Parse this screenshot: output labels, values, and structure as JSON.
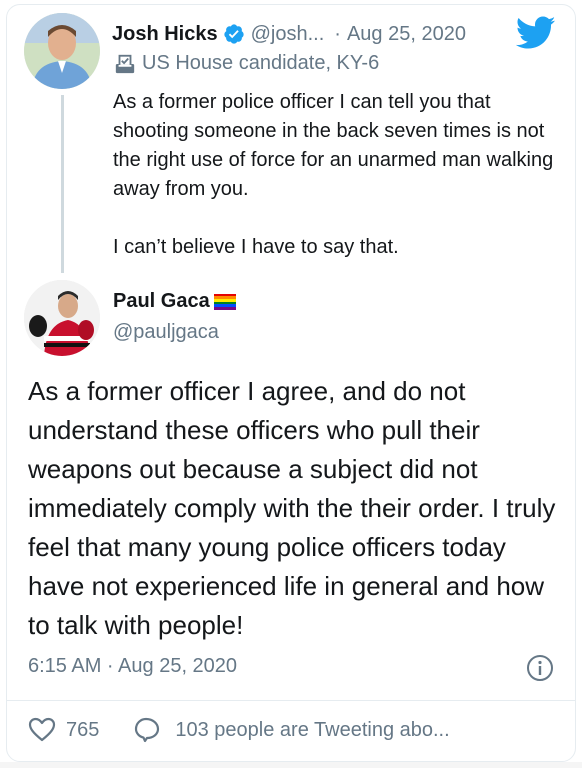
{
  "parent": {
    "name": "Josh Hicks",
    "handle": "@josh...",
    "separator": "·",
    "date": "Aug 25, 2020",
    "label": "US House candidate, KY-6",
    "paragraphs": [
      "As a former police officer I can tell you that shooting someone in the back seven times is not the right use of force for an unarmed man walking away from you.",
      "I can’t believe I have to say that."
    ]
  },
  "reply": {
    "name": "Paul Gaca",
    "handle": "@pauljgaca",
    "text": "As a former officer I agree, and do not understand these officers who pull their weapons out because a subject did not immediately comply with the their order. I truly feel that many young police officers today have not experienced life in general and how to talk with people!",
    "timestamp": "6:15 AM · Aug 25, 2020"
  },
  "actions": {
    "like_count": "765",
    "tweeting_text": "103 people are Tweeting abo..."
  },
  "colors": {
    "twitter_blue": "#1da1f2",
    "secondary_text": "#657786",
    "primary_text": "#14171a",
    "rainbow": [
      "#e40303",
      "#ff8c00",
      "#ffed00",
      "#008026",
      "#004dff",
      "#750787"
    ]
  },
  "icons": {
    "verified": "verified-badge-icon",
    "bird": "twitter-bird-icon",
    "label": "ballot-box-icon",
    "info": "info-icon",
    "like": "heart-icon",
    "reply": "reply-bubble-icon"
  }
}
